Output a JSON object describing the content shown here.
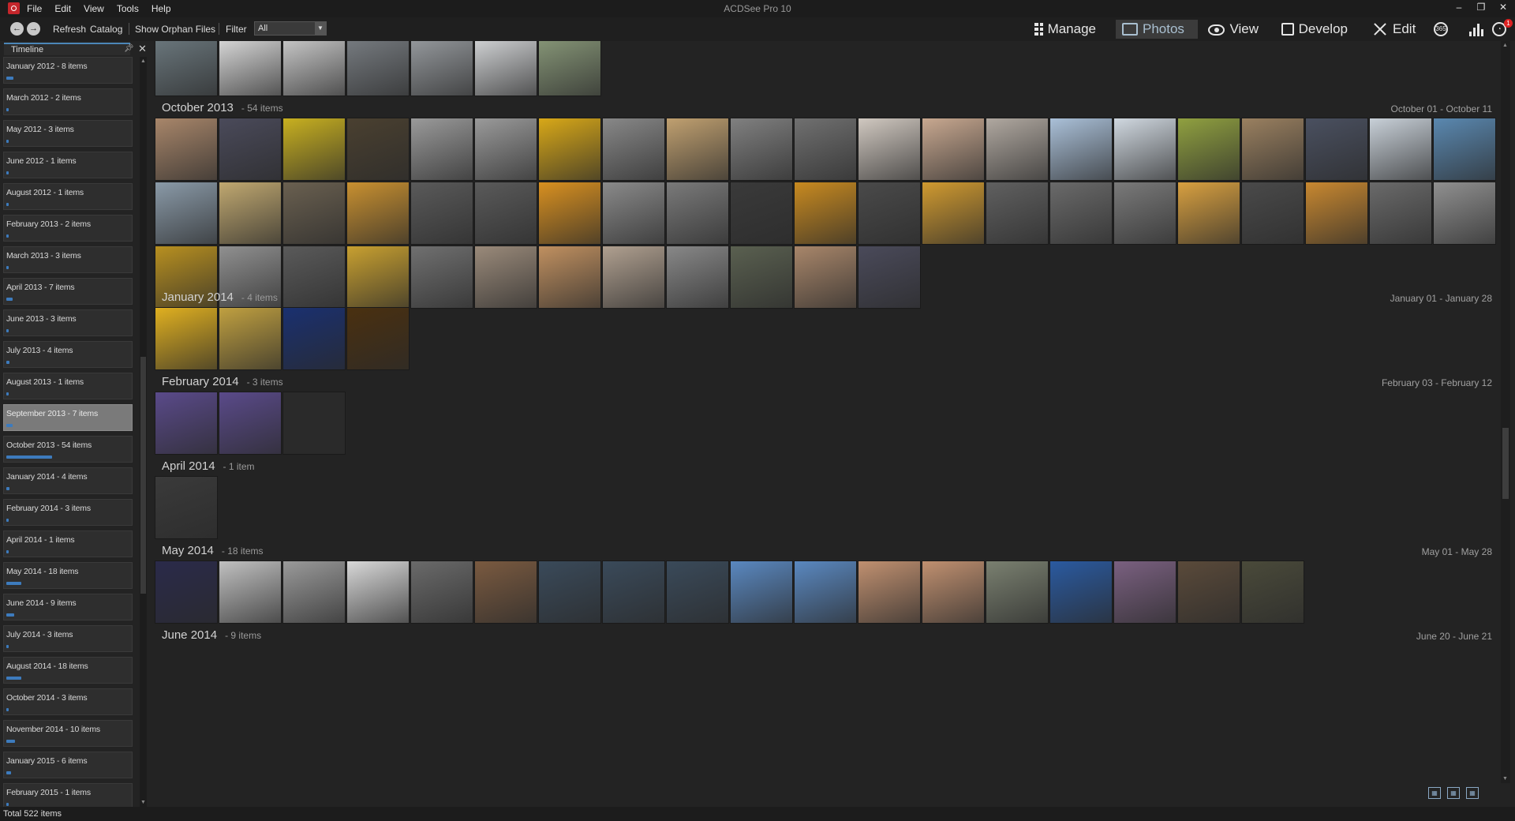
{
  "app": {
    "title": "ACDSee Pro 10",
    "menu": [
      "File",
      "Edit",
      "View",
      "Tools",
      "Help"
    ]
  },
  "toolbar": {
    "refresh": "Refresh",
    "catalog": "Catalog",
    "show_orphan": "Show Orphan Files",
    "filter_label": "Filter",
    "filter_value": "All"
  },
  "modes": {
    "manage": "Manage",
    "photos": "Photos",
    "view": "View",
    "develop": "Develop",
    "edit": "Edit",
    "ico365": "365",
    "notifications": "1",
    "active": "photos"
  },
  "sidebar": {
    "tab_title": "Timeline",
    "items": [
      {
        "label": "January 2012 - 8 items",
        "count": 8
      },
      {
        "label": "March 2012 - 2 items",
        "count": 2
      },
      {
        "label": "May 2012 - 3 items",
        "count": 3
      },
      {
        "label": "June 2012 - 1 items",
        "count": 1
      },
      {
        "label": "August 2012 - 1 items",
        "count": 1
      },
      {
        "label": "February 2013 - 2 items",
        "count": 2
      },
      {
        "label": "March 2013 - 3 items",
        "count": 3
      },
      {
        "label": "April 2013 - 7 items",
        "count": 7
      },
      {
        "label": "June 2013 - 3 items",
        "count": 3
      },
      {
        "label": "July 2013 - 4 items",
        "count": 4
      },
      {
        "label": "August 2013 - 1 items",
        "count": 1
      },
      {
        "label": "September 2013 - 7 items",
        "count": 7,
        "selected": true
      },
      {
        "label": "October 2013 - 54 items",
        "count": 54
      },
      {
        "label": "January 2014 - 4 items",
        "count": 4
      },
      {
        "label": "February 2014 - 3 items",
        "count": 3
      },
      {
        "label": "April 2014 - 1 items",
        "count": 1
      },
      {
        "label": "May 2014 - 18 items",
        "count": 18
      },
      {
        "label": "June 2014 - 9 items",
        "count": 9
      },
      {
        "label": "July 2014 - 3 items",
        "count": 3
      },
      {
        "label": "August 2014 - 18 items",
        "count": 18
      },
      {
        "label": "October 2014 - 3 items",
        "count": 3
      },
      {
        "label": "November 2014 - 10 items",
        "count": 10
      },
      {
        "label": "January 2015 - 6 items",
        "count": 6
      },
      {
        "label": "February 2015 - 1 items",
        "count": 1
      }
    ]
  },
  "groups": [
    {
      "title": "",
      "count": "",
      "range": "",
      "n": 7,
      "palette": [
        "#6d7a80",
        "#e0e0e0",
        "#cfcfcf",
        "#7a7f84",
        "#9a9ea2",
        "#d8dadc",
        "#8a9a7a"
      ]
    },
    {
      "title": "October 2013",
      "count": "- 54 items",
      "range": "October 01 - October 11",
      "n": 54,
      "palette": [
        "#a8866a",
        "#4a4a5a",
        "#c8b020",
        "#4a4030",
        "#9a9a9a",
        "#9a9a9a",
        "#d8a818",
        "#888888",
        "#c0a070",
        "#808080",
        "#707070",
        "#d0c8c0",
        "#c8a890",
        "#b0a8a0",
        "#aac0d8",
        "#d0d8e0",
        "#90a040",
        "#9a8060",
        "#4a5060",
        "#c8d0d8",
        "#5a88b0",
        "#8a9aa8",
        "#c0a870",
        "#6a6050",
        "#c89030",
        "#5a5a5a",
        "#5a5a5a",
        "#d89020",
        "#8a8a8a",
        "#7a7a7a",
        "#3a3a3a",
        "#c88a20",
        "#4a4a4a",
        "#d09a30",
        "#606060",
        "#6a6a6a",
        "#7a7a7a",
        "#d8a040",
        "#4a4a4a",
        "#c88830",
        "#6a6a6a",
        "#909090",
        "#b89020",
        "#909090",
        "#5a5a5a",
        "#c8a030",
        "#707070",
        "#9a8a7a",
        "#c09060",
        "#b0a090",
        "#888888",
        "#5a6050"
      ]
    },
    {
      "title": "January 2014",
      "count": "- 4 items",
      "range": "January 01 - January 28",
      "n": 4,
      "palette": [
        "#e0b020",
        "#c0a040",
        "#1a3070",
        "#4a3010"
      ]
    },
    {
      "title": "February 2014",
      "count": "- 3 items",
      "range": "February 03 - February 12",
      "n": 3,
      "palette": [
        "#5a4a8a",
        "#5a4a8a",
        "#2a2a2a"
      ]
    },
    {
      "title": "April 2014",
      "count": "- 1 item",
      "range": "",
      "n": 1,
      "palette": [
        "#3a3a3a"
      ]
    },
    {
      "title": "May 2014",
      "count": "- 18 items",
      "range": "May 01 - May 28",
      "n": 18,
      "palette": [
        "#2a2a4a",
        "#c0c0c0",
        "#9a9a9a",
        "#d8d8d8",
        "#6a6a6a",
        "#7a5a40",
        "#3a4a5a",
        "#3a4a5a",
        "#3a4a5a",
        "#5a88c0",
        "#5a88c0",
        "#c09070",
        "#c09070",
        "#7a8070",
        "#2a5aa0",
        "#7a6080",
        "#5a4a3a",
        "#4a4a3a"
      ]
    },
    {
      "title": "June 2014",
      "count": "- 9 items",
      "range": "June 20 - June 21",
      "n": 0,
      "palette": []
    }
  ],
  "status": {
    "total": "Total 522 items"
  }
}
